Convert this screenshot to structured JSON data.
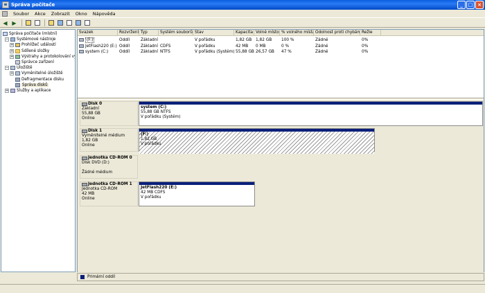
{
  "window": {
    "title": "Správa počítače"
  },
  "menu": [
    "Soubor",
    "Akce",
    "Zobrazit",
    "Okno",
    "Nápověda"
  ],
  "toolbar": {
    "icons": [
      "back-icon",
      "forward-icon",
      "up-icon",
      "show-hide-tree-icon",
      "properties-icon",
      "help-icon",
      "refresh-icon",
      "export-icon",
      "view-icon"
    ]
  },
  "tree": [
    {
      "label": "Správa počítače (místní)",
      "level": 0,
      "expander": "",
      "icon": "computer"
    },
    {
      "label": "Systémové nástroje",
      "level": 1,
      "expander": "−",
      "icon": "tools"
    },
    {
      "label": "Prohlížeč událostí",
      "level": 2,
      "expander": "+",
      "icon": "ev"
    },
    {
      "label": "Sdílené složky",
      "level": 2,
      "expander": "+",
      "icon": "folder"
    },
    {
      "label": "Výstrahy a protokolování výk",
      "level": 2,
      "expander": "+",
      "icon": "perf"
    },
    {
      "label": "Správce zařízení",
      "level": 2,
      "expander": "",
      "icon": "dev"
    },
    {
      "label": "Úložiště",
      "level": 1,
      "expander": "−",
      "icon": "store"
    },
    {
      "label": "Vyměnitelné úložiště",
      "level": 2,
      "expander": "+",
      "icon": "store"
    },
    {
      "label": "Defragmentace disku",
      "level": 2,
      "expander": "",
      "icon": "disk"
    },
    {
      "label": "Správa disků",
      "level": 2,
      "expander": "",
      "icon": "disk",
      "selected": true
    },
    {
      "label": "Služby a aplikace",
      "level": 1,
      "expander": "+",
      "icon": "svc"
    }
  ],
  "volume_table": {
    "headers": [
      "Svazek",
      "Rozvržení",
      "Typ",
      "Systém souborů",
      "Stav",
      "Kapacita",
      "Volné místo",
      "% volného místa",
      "Odolnost proti chybám",
      "Režie"
    ],
    "rows": [
      [
        "(F:)",
        "Oddíl",
        "Základní",
        "",
        "V pořádku",
        "1,82 GB",
        "1,82 GB",
        "100 %",
        "Žádné",
        "0%"
      ],
      [
        "JetFlash220 (E:)",
        "Oddíl",
        "Základní",
        "CDFS",
        "V pořádku",
        "42 MB",
        "0 MB",
        "0 %",
        "Žádné",
        "0%"
      ],
      [
        "system (C:)",
        "Oddíl",
        "Základní",
        "NTFS",
        "V pořádku (Systém)",
        "55,88 GB",
        "26,57 GB",
        "47 %",
        "Žádné",
        "0%"
      ]
    ]
  },
  "disks": [
    {
      "name": "Disk 0",
      "type": "Základní",
      "size": "55,88 GB",
      "status": "Online",
      "partition": {
        "name": "system (C:)",
        "detail": "55,88 GB NTFS",
        "status": "V pořádku (Systém)"
      }
    },
    {
      "name": "Disk 1",
      "type": "Vyměnitelné médium",
      "size": "1,82 GB",
      "status": "Online",
      "partition": {
        "name": "(F:)",
        "detail": "1,82 GB",
        "status": "V pořádku"
      }
    },
    {
      "name": "Jednotka CD-ROM 0",
      "type": "Disk DVD (D:)",
      "size": "",
      "status": "Žádné médium"
    },
    {
      "name": "Jednotka CD-ROM 1",
      "type": "Jednotka CD-ROM",
      "size": "42 MB",
      "status": "Online",
      "partition": {
        "name": "JetFlash220 (E:)",
        "detail": "42 MB CDFS",
        "status": "V pořádku"
      }
    }
  ],
  "legend": {
    "label": "Primární oddíl",
    "color": "#0a1f7a"
  }
}
